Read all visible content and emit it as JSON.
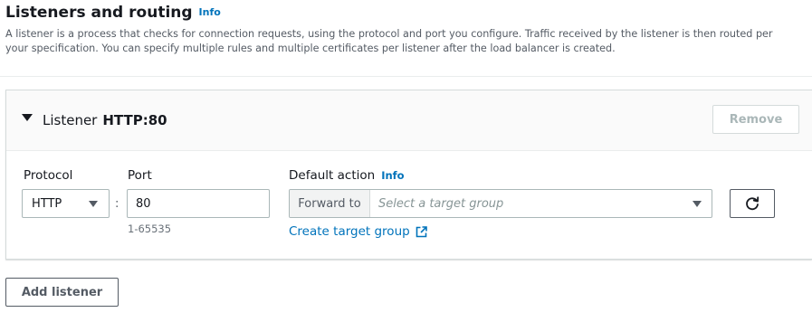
{
  "section": {
    "title": "Listeners and routing",
    "info_label": "Info",
    "description": "A listener is a process that checks for connection requests, using the protocol and port you configure. Traffic received by the listener is then routed per your specification. You can specify multiple rules and multiple certificates per listener after the load balancer is created."
  },
  "listener": {
    "label": "Listener",
    "value": "HTTP:80",
    "remove_label": "Remove",
    "protocol": {
      "label": "Protocol",
      "selected": "HTTP"
    },
    "separator": ":",
    "port": {
      "label": "Port",
      "value": "80",
      "hint": "1-65535"
    },
    "default_action": {
      "label": "Default action",
      "info_label": "Info",
      "prefix": "Forward to",
      "placeholder": "Select a target group",
      "create_link": "Create target group"
    }
  },
  "add_listener_label": "Add listener",
  "colors": {
    "link": "#0073bb",
    "text": "#16191f",
    "muted": "#545b64",
    "border": "#aab7b8"
  }
}
